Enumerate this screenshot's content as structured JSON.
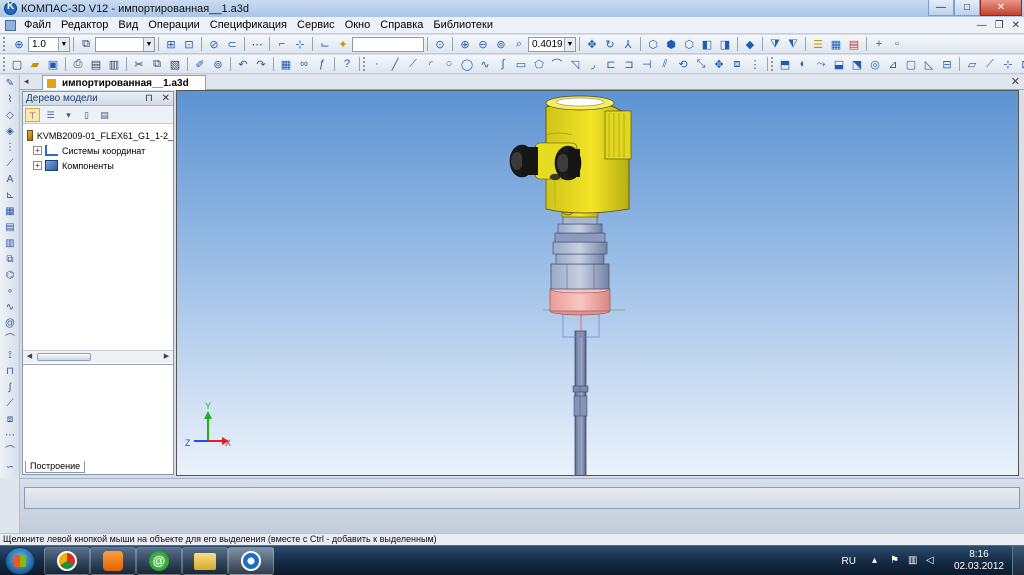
{
  "window": {
    "title": "КОМПАС-3D V12 - импортированная__1.a3d",
    "buttons": {
      "minimize": "—",
      "maximize": "□",
      "close": "✕"
    }
  },
  "menu": {
    "items": [
      "Файл",
      "Редактор",
      "Вид",
      "Операции",
      "Спецификация",
      "Сервис",
      "Окно",
      "Справка",
      "Библиотеки"
    ],
    "right_controls": {
      "minimize": "—",
      "restore": "❐",
      "close": "✕"
    }
  },
  "toolbar1": {
    "step_value": "1.0",
    "layer_value": "",
    "coord_value": "",
    "zoom_value": "0.4019"
  },
  "document_tab": {
    "label": "импортированная__1.a3d",
    "nav": "◂",
    "close": "✕"
  },
  "model_tree": {
    "title": "Дерево модели",
    "pin": "⊓",
    "close": "✕",
    "root": "KVMB2009-01_FLEX61_G1_1-2_",
    "items": [
      {
        "label": "Системы координат",
        "expander": "+"
      },
      {
        "label": "Компоненты",
        "expander": "+"
      }
    ],
    "bottom_tab": "Построение"
  },
  "viewport": {
    "axis_labels": {
      "x": "X",
      "y": "Y",
      "z": "Z"
    }
  },
  "status": {
    "message": "Щелкните левой кнопкой мыши на объекте для его выделения (вместе с Ctrl - добавить к выделенным)"
  },
  "taskbar": {
    "apps": [
      "chrome-icon",
      "media-player-icon",
      "mail-agent-icon",
      "explorer-icon",
      "kompas-icon"
    ],
    "agent_glyph": "@",
    "language": "RU",
    "time": "8:16",
    "date": "02.03.2012"
  },
  "colors": {
    "housing_yellow": "#f2e526",
    "cap_black": "#151515",
    "flange_blue": "#7f8fb2",
    "gasket_pink": "#efa9a4",
    "probe_blue": "#6f7ea8",
    "axis_x": "#e02020",
    "axis_y": "#20b020",
    "axis_z": "#2050e0"
  }
}
